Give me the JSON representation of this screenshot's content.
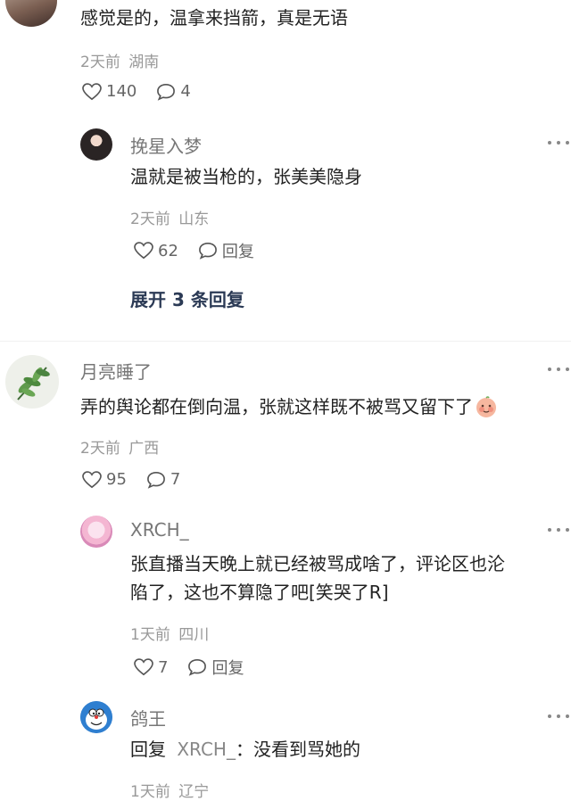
{
  "comments": [
    {
      "text": "感觉是的，温拿来挡箭，真是无语",
      "time": "2天前",
      "location": "湖南",
      "likes": "140",
      "replies": "4"
    },
    {
      "username": "挽星入梦",
      "text": "温就是被当枪的，张美美隐身",
      "time": "2天前",
      "location": "山东",
      "likes": "62",
      "reply_label": "回复"
    },
    {
      "expand_label": "展开 3 条回复"
    },
    {
      "username": "月亮睡了",
      "text": "弄的舆论都在倒向温，张就这样既不被骂又留下了",
      "time": "2天前",
      "location": "广西",
      "likes": "95",
      "replies": "7"
    },
    {
      "username": "XRCH_",
      "text_line1": "张直播当天晚上就已经被骂成啥了，评论区也沦",
      "text_line2": "陷了，这也不算隐了吧[笑哭了R]",
      "time": "1天前",
      "location": "四川",
      "likes": "7",
      "reply_label": "回复"
    },
    {
      "username": "鸽王",
      "reply_prefix": "回复",
      "reply_to": "XRCH_",
      "text": "：没看到骂她的",
      "time": "1天前",
      "location": "辽宁"
    }
  ],
  "icons": {
    "like": "heart-outline-icon",
    "comment": "speech-bubble-icon",
    "more": "more-dots-icon",
    "emoji": "blushing-face-emoji"
  },
  "colors": {
    "text": "#222222",
    "meta": "#999999",
    "username": "#777777",
    "expand": "#2b3a55"
  }
}
